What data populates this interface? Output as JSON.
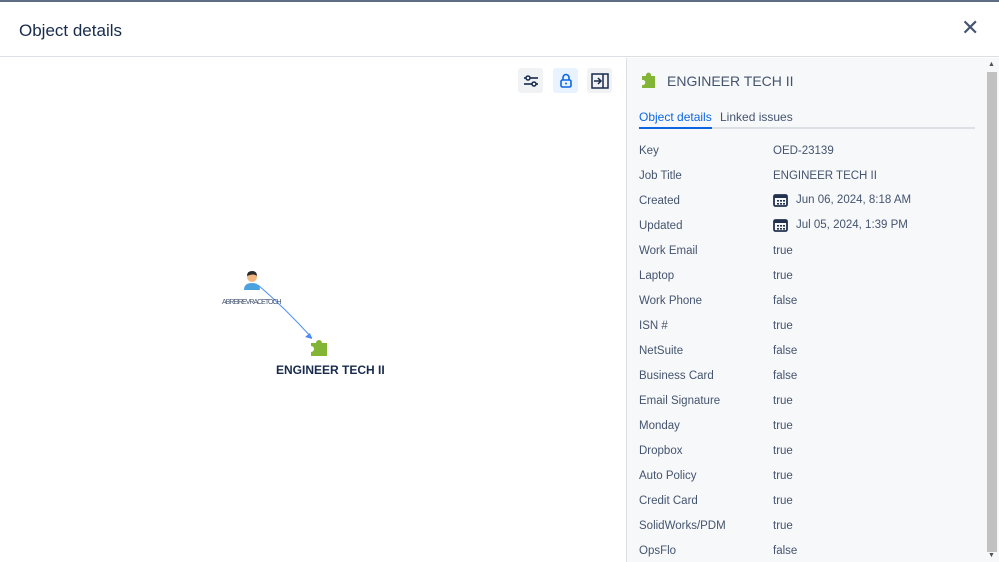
{
  "dialog": {
    "title": "Object details"
  },
  "graph": {
    "source_label": "ABREIREVRACETOCH",
    "target_label": "ENGINEER TECH II"
  },
  "panel": {
    "title": "ENGINEER TECH II",
    "tabs": [
      {
        "label": "Object details",
        "active": true
      },
      {
        "label": "Linked issues",
        "active": false
      }
    ],
    "fields": [
      {
        "label": "Key",
        "value": "OED-23139"
      },
      {
        "label": "Job Title",
        "value": "ENGINEER TECH II"
      },
      {
        "label": "Created",
        "value": "Jun 06, 2024, 8:18 AM",
        "icon": "calendar"
      },
      {
        "label": "Updated",
        "value": "Jul 05, 2024, 1:39 PM",
        "icon": "calendar"
      },
      {
        "label": "Work Email",
        "value": "true"
      },
      {
        "label": "Laptop",
        "value": "true"
      },
      {
        "label": "Work Phone",
        "value": "false"
      },
      {
        "label": "ISN #",
        "value": "true"
      },
      {
        "label": "NetSuite",
        "value": "false"
      },
      {
        "label": "Business Card",
        "value": "false"
      },
      {
        "label": "Email Signature",
        "value": "true"
      },
      {
        "label": "Monday",
        "value": "true"
      },
      {
        "label": "Dropbox",
        "value": "true"
      },
      {
        "label": "Auto Policy",
        "value": "true"
      },
      {
        "label": "Credit Card",
        "value": "true"
      },
      {
        "label": "SolidWorks/PDM",
        "value": "true"
      },
      {
        "label": "OpsFlo",
        "value": "false"
      }
    ]
  },
  "colors": {
    "accent": "#0c66e4",
    "object_icon": "#82b536"
  }
}
